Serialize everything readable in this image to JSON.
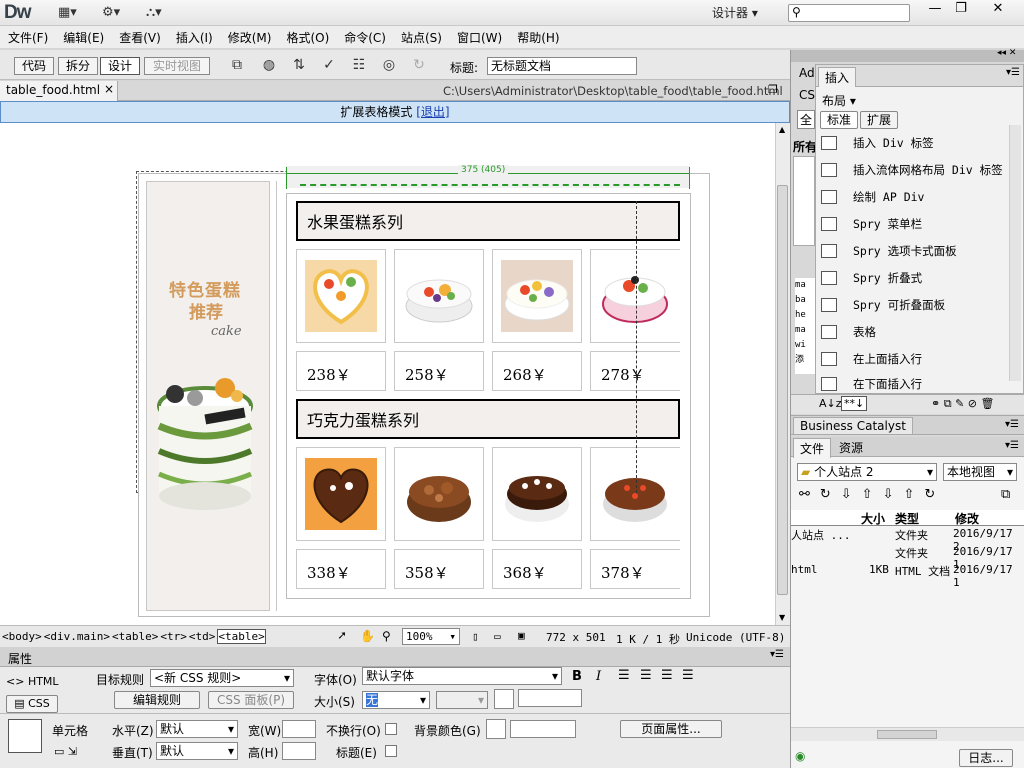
{
  "app": {
    "logo": "Dw",
    "workspace": "设计器"
  },
  "window_controls": {
    "minimize": "—",
    "restore": "❐",
    "close": "✕"
  },
  "menu": [
    "文件(F)",
    "编辑(E)",
    "查看(V)",
    "插入(I)",
    "修改(M)",
    "格式(O)",
    "命令(C)",
    "站点(S)",
    "窗口(W)",
    "帮助(H)"
  ],
  "toolbar": {
    "code": "代码",
    "split": "拆分",
    "design": "设计",
    "live": "实时视图",
    "title_label": "标题:",
    "title_value": "无标题文档"
  },
  "tab": {
    "filename": "table_food.html",
    "close": "×",
    "path": "C:\\Users\\Administrator\\Desktop\\table_food\\table_food.html"
  },
  "extended_mode": {
    "label": "扩展表格模式",
    "exit": "[退出]"
  },
  "page": {
    "width_marker": "375 (405)",
    "side_title_1": "特色蛋糕",
    "side_title_2": "推荐",
    "side_cake": "cake",
    "sections": [
      {
        "title": "水果蛋糕系列",
        "prices": [
          "238￥",
          "258￥",
          "268￥",
          "278￥"
        ]
      },
      {
        "title": "巧克力蛋糕系列",
        "prices": [
          "338￥",
          "358￥",
          "368￥",
          "378￥"
        ]
      }
    ]
  },
  "status": {
    "tags": [
      "<body>",
      "<div.main>",
      "<table>",
      "<tr>",
      "<td>",
      "<table>"
    ],
    "zoom": "100%",
    "size": "772 x 501",
    "filesize": "1 K / 1 秒",
    "encoding": "Unicode (UTF-8)"
  },
  "properties": {
    "header": "属性",
    "html": "HTML",
    "css": "CSS",
    "target_rule_label": "目标规则",
    "target_rule_value": "<新 CSS 规则>",
    "edit_rule": "编辑规则",
    "css_panel": "CSS 面板(P)",
    "font_label": "字体(O)",
    "font_value": "默认字体",
    "size_label": "大小(S)",
    "size_value": "无",
    "bold": "B",
    "italic": "I",
    "cell_label": "单元格",
    "horz_label": "水平(Z)",
    "horz_value": "默认",
    "vert_label": "垂直(T)",
    "vert_value": "默认",
    "width_label": "宽(W)",
    "height_label": "高(H)",
    "nowrap_label": "不换行(O)",
    "bg_label": "背景颜色(G)",
    "header_label": "标题(E)",
    "page_props": "页面属性..."
  },
  "insert_panel": {
    "side_tabs": [
      "Ad",
      "CS",
      "全",
      "所有"
    ],
    "tab": "插入",
    "category": "布局",
    "std": "标准",
    "ext": "扩展",
    "items": [
      "插入 Div 标签",
      "插入流体网格布局 Div 标签",
      "绘制 AP Div",
      "Spry 菜单栏",
      "Spry 选项卡式面板",
      "Spry 折叠式",
      "Spry 可折叠面板",
      "表格",
      "在上面插入行",
      "在下面插入行"
    ]
  },
  "bc_panel": {
    "title": "Business Catalyst"
  },
  "files_panel": {
    "tabs": [
      "文件",
      "资源"
    ],
    "site": "个人站点 2",
    "view": "本地视图",
    "columns": [
      "大小",
      "类型",
      "修改"
    ],
    "rows": [
      {
        "name": "人站点 ...",
        "size": "",
        "type": "文件夹",
        "date": "2016/9/17 2"
      },
      {
        "name": "",
        "size": "",
        "type": "文件夹",
        "date": "2016/9/17 1"
      },
      {
        "name": "html",
        "size": "1KB",
        "type": "HTML 文档",
        "date": "2016/9/17 1"
      }
    ],
    "log": "日志..."
  }
}
